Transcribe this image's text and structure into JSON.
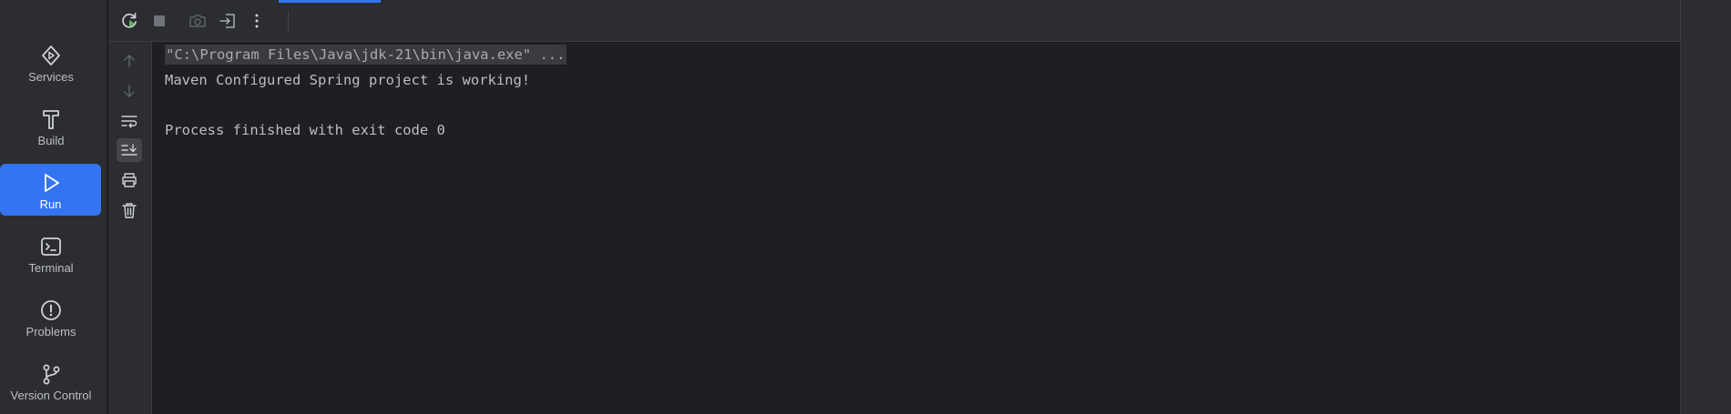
{
  "tool_windows": [
    {
      "label": "Services",
      "icon": "services-icon",
      "active": false
    },
    {
      "label": "Build",
      "icon": "hammer-icon",
      "active": false
    },
    {
      "label": "Run",
      "icon": "run-icon",
      "active": true
    },
    {
      "label": "Terminal",
      "icon": "terminal-icon",
      "active": false
    },
    {
      "label": "Problems",
      "icon": "problems-icon",
      "active": false
    },
    {
      "label": "Version Control",
      "icon": "branch-icon",
      "active": false
    }
  ],
  "toolbar": {
    "icons": [
      "rerun-icon",
      "stop-icon",
      "camera-icon",
      "exit-icon",
      "more-vertical-icon"
    ]
  },
  "side_toolbar": {
    "icons": [
      "arrow-up-icon",
      "arrow-down-icon",
      "soft-wrap-icon",
      "scroll-to-end-icon",
      "print-icon",
      "trash-icon"
    ]
  },
  "console": {
    "command": "\"C:\\Program Files\\Java\\jdk-21\\bin\\java.exe\" ...",
    "output_line": "Maven Configured Spring project is working!",
    "exit_line": "Process finished with exit code 0"
  },
  "colors": {
    "accent": "#3574f0",
    "background": "#1e1f22",
    "panel": "#2b2d30",
    "rerun_green": "#5fb865"
  }
}
